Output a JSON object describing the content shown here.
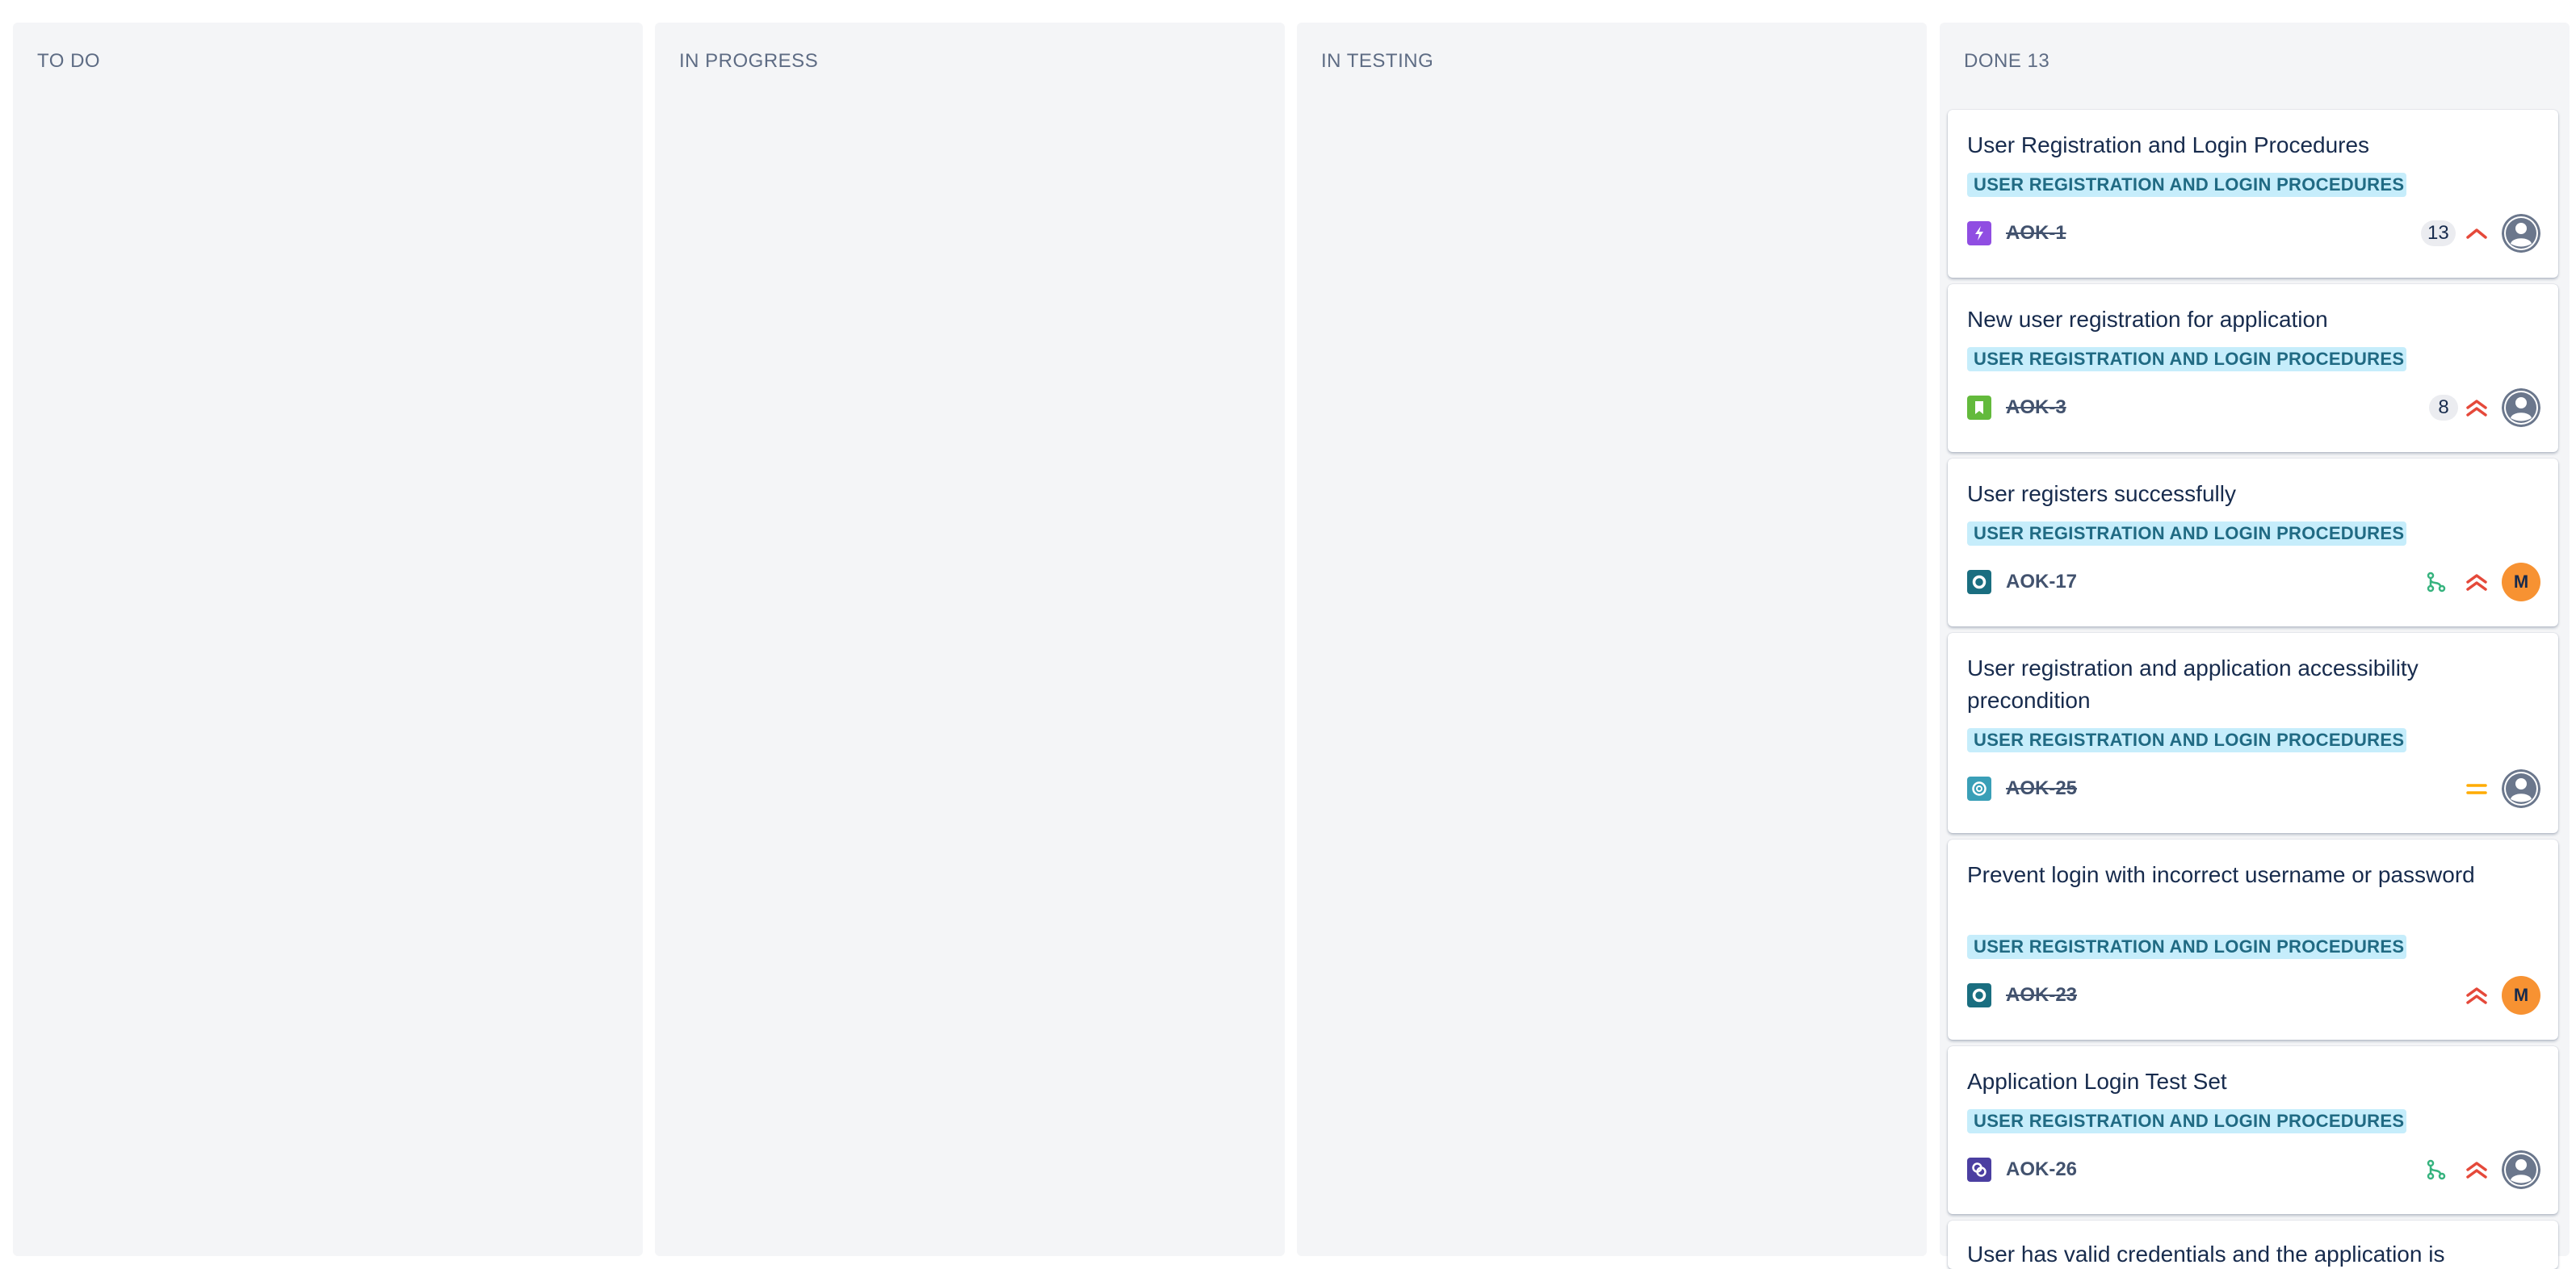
{
  "columns": [
    {
      "title": "TO DO"
    },
    {
      "title": "IN PROGRESS"
    },
    {
      "title": "IN TESTING"
    },
    {
      "title": "DONE 13"
    }
  ],
  "cards": [
    {
      "title": "User Registration and Login Procedures",
      "label": "USER REGISTRATION AND LOGIN PROCEDURES",
      "type_icon": "epic-lightning-icon",
      "type_color": "#904ee2",
      "key": "AOK-1",
      "done": true,
      "estimate": "13",
      "priority": "high-priority-icon",
      "avatar": "unassigned-avatar"
    },
    {
      "title": "New user registration for application",
      "label": "USER REGISTRATION AND LOGIN PROCEDURES",
      "type_icon": "story-bookmark-icon",
      "type_color": "#63ba3c",
      "key": "AOK-3",
      "done": true,
      "estimate": "8",
      "priority": "highest-priority-icon",
      "avatar": "unassigned-avatar"
    },
    {
      "title": "User registers successfully",
      "label": "USER REGISTRATION AND LOGIN PROCEDURES",
      "type_icon": "test-icon",
      "type_color": "#1a6e80",
      "key": "AOK-17",
      "done": false,
      "branch": true,
      "priority": "highest-priority-icon",
      "avatar": "M"
    },
    {
      "title": "User registration and application accessibility precondition",
      "label": "USER REGISTRATION AND LOGIN PROCEDURES",
      "type_icon": "precondition-icon",
      "type_color": "#3a9fb7",
      "key": "AOK-25",
      "done": true,
      "priority": "medium-priority-icon",
      "avatar": "unassigned-avatar"
    },
    {
      "title": "Prevent login with incorrect username or password",
      "label": "USER REGISTRATION AND LOGIN PROCEDURES",
      "type_icon": "test-icon",
      "type_color": "#1a6e80",
      "key": "AOK-23",
      "done": true,
      "priority": "highest-priority-icon",
      "avatar": "M"
    },
    {
      "title": "Application Login Test Set",
      "label": "USER REGISTRATION AND LOGIN PROCEDURES",
      "type_icon": "test-set-icon",
      "type_color": "#4b3fa1",
      "key": "AOK-26",
      "done": false,
      "branch": true,
      "priority": "highest-priority-icon",
      "avatar": "unassigned-avatar"
    },
    {
      "title": "User has valid credentials and the application is",
      "partial": true
    }
  ],
  "colors": {
    "column_bg": "#f4f5f7",
    "label_bg": "#c6edfb",
    "label_text": "#206a83",
    "priority_red": "#e5493a",
    "priority_medium": "#ffab00",
    "avatar_orange": "#f79232"
  }
}
